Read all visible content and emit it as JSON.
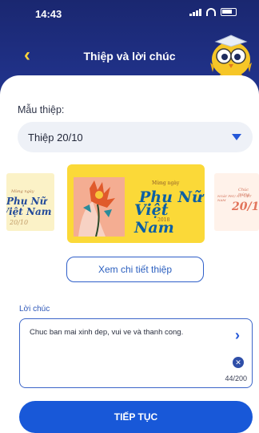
{
  "status_bar": {
    "time": "14:43"
  },
  "header": {
    "title": "Thiệp và lời chúc",
    "back_icon": "chevron-left-icon",
    "mascot_icon": "owl-mascot-icon"
  },
  "template": {
    "label": "Mẫu thiệp:",
    "selected": "Thiệp 20/10"
  },
  "carousel": {
    "left": {
      "small": "Mừng ngày",
      "line1": "Phụ Nữ",
      "line2": "Việt Nam",
      "line3": "20/10"
    },
    "main": {
      "small": "Mừng ngày",
      "line1": "Phụ Nữ",
      "line2": "Việt Nam",
      "year": "2018"
    },
    "right": {
      "small": "Chúc mừng",
      "sub": "NGÀY PHỤ NỮ VIỆT NAM",
      "line1": "20/10"
    }
  },
  "detail_button": "Xem chi tiết thiệp",
  "wish": {
    "label": "Lời chúc",
    "text": "Chuc ban mai xinh dep, vui ve và thanh cong.",
    "counter": "44/200"
  },
  "continue_button": "TIẾP TỤC",
  "colors": {
    "header": "#1a2770",
    "accent": "#1858d8",
    "back": "#ffd43b"
  }
}
